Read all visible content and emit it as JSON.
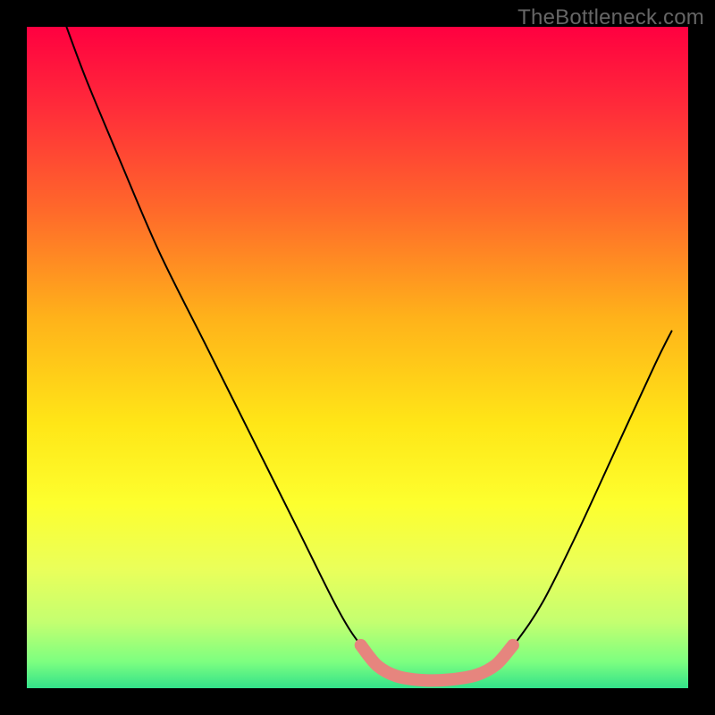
{
  "watermark": "TheBottleneck.com",
  "chart_data": {
    "type": "line",
    "title": "",
    "xlabel": "",
    "ylabel": "",
    "xlim": [
      0,
      100
    ],
    "ylim": [
      0,
      100
    ],
    "background_gradient": {
      "stops": [
        {
          "offset": 0.0,
          "color": "#ff0040"
        },
        {
          "offset": 0.12,
          "color": "#ff2b3a"
        },
        {
          "offset": 0.28,
          "color": "#ff6a2a"
        },
        {
          "offset": 0.44,
          "color": "#ffb21a"
        },
        {
          "offset": 0.6,
          "color": "#ffe617"
        },
        {
          "offset": 0.72,
          "color": "#fdff2e"
        },
        {
          "offset": 0.82,
          "color": "#eaff5a"
        },
        {
          "offset": 0.9,
          "color": "#c4ff70"
        },
        {
          "offset": 0.96,
          "color": "#7dff80"
        },
        {
          "offset": 1.0,
          "color": "#33e28a"
        }
      ]
    },
    "series": [
      {
        "name": "bottleneck-curve",
        "style": "thin-black",
        "points": [
          {
            "x": 6.0,
            "y": 100.0
          },
          {
            "x": 9.0,
            "y": 92.0
          },
          {
            "x": 14.0,
            "y": 80.0
          },
          {
            "x": 20.0,
            "y": 66.0
          },
          {
            "x": 27.0,
            "y": 52.0
          },
          {
            "x": 34.0,
            "y": 38.0
          },
          {
            "x": 41.0,
            "y": 24.0
          },
          {
            "x": 47.0,
            "y": 12.0
          },
          {
            "x": 50.5,
            "y": 6.5
          },
          {
            "x": 54.0,
            "y": 3.0
          },
          {
            "x": 58.0,
            "y": 1.4
          },
          {
            "x": 63.0,
            "y": 1.2
          },
          {
            "x": 68.0,
            "y": 2.0
          },
          {
            "x": 71.0,
            "y": 3.5
          },
          {
            "x": 74.0,
            "y": 7.0
          },
          {
            "x": 78.0,
            "y": 13.0
          },
          {
            "x": 83.0,
            "y": 23.0
          },
          {
            "x": 89.0,
            "y": 36.0
          },
          {
            "x": 95.0,
            "y": 49.0
          },
          {
            "x": 97.5,
            "y": 54.0
          }
        ]
      },
      {
        "name": "optimal-zone-marker",
        "style": "thick-salmon",
        "points": [
          {
            "x": 50.5,
            "y": 6.5
          },
          {
            "x": 53.0,
            "y": 3.4
          },
          {
            "x": 56.0,
            "y": 1.8
          },
          {
            "x": 60.0,
            "y": 1.2
          },
          {
            "x": 64.0,
            "y": 1.3
          },
          {
            "x": 68.0,
            "y": 2.0
          },
          {
            "x": 71.0,
            "y": 3.6
          },
          {
            "x": 73.5,
            "y": 6.5
          }
        ]
      }
    ]
  }
}
